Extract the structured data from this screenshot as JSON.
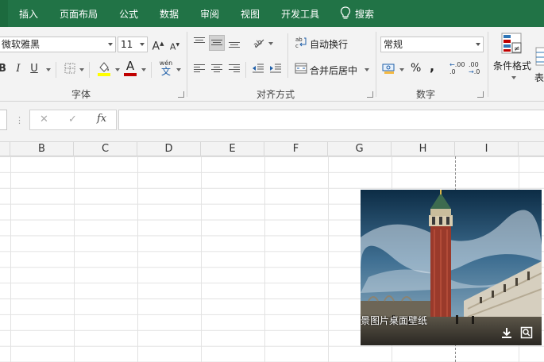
{
  "menu": {
    "tabs": [
      "插入",
      "页面布局",
      "公式",
      "数据",
      "审阅",
      "视图",
      "开发工具"
    ],
    "search_label": "搜索"
  },
  "ribbon": {
    "font": {
      "family_value": "微软雅黑",
      "size_value": "11",
      "grow_label": "A",
      "shrink_label": "A",
      "bold_label": "B",
      "italic_label": "I",
      "underline_label": "U",
      "font_color_label": "A",
      "phonetic_label": "wén",
      "phonetic_glyph": "文",
      "group_label": "字体"
    },
    "alignment": {
      "wrap_text_label": "自动换行",
      "merge_label": "合并后居中",
      "group_label": "对齐方式"
    },
    "number": {
      "format_value": "常规",
      "percent_label": "%",
      "comma_label": ",",
      "increase_decimal_label": ".00",
      "decrease_decimal_label": ".00",
      "group_label": "数字"
    },
    "styles": {
      "conditional_format_label": "条件格式",
      "table_label_partial": "表"
    }
  },
  "formula_bar": {
    "cancel_label": "✕",
    "enter_label": "✓",
    "fx_label": "fx",
    "value": ""
  },
  "grid": {
    "columns": [
      "B",
      "C",
      "D",
      "E",
      "F",
      "G",
      "H",
      "I"
    ]
  },
  "picture": {
    "caption": "景图片桌面壁纸"
  },
  "colors": {
    "menu_bar": "#217346",
    "font_color_bar": "#c00000",
    "highlight_bar": "#ffff00"
  }
}
